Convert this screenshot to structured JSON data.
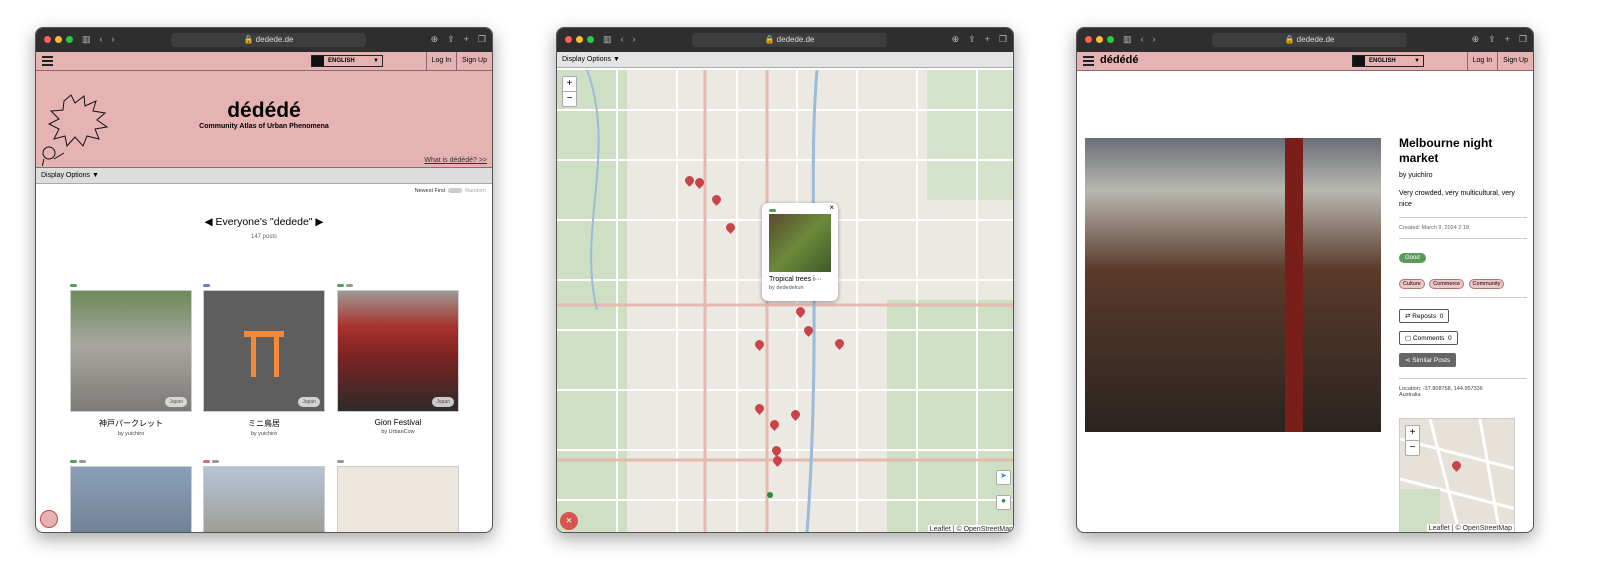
{
  "browser": {
    "url": "dedede.de"
  },
  "home": {
    "language": "ENGLISH",
    "login": "Log In",
    "signup": "Sign Up",
    "site_title": "dédédé",
    "tagline": "Community Atlas of Urban Phenomena",
    "about_link": "What is dédédé? >>",
    "display_options": "Display Options ▼",
    "sort_left": "Newest First",
    "sort_right": "Random",
    "feed_title": "Everyone's \"dedede\"",
    "post_count": "147 posts",
    "posts": [
      {
        "title": "神戸パークレット",
        "author": "by yuichiro",
        "country": "Japan"
      },
      {
        "title": "ミニ鳥居",
        "author": "by yuichiro",
        "country": "Japan"
      },
      {
        "title": "Gion Festival",
        "author": "by UrbanCow",
        "country": "Japan"
      }
    ]
  },
  "map": {
    "display_options": "Display Options ▼",
    "zoom_in": "+",
    "zoom_out": "−",
    "popup": {
      "title": "Tropical trees i···",
      "author": "by dededekun",
      "close": "×"
    },
    "attribution": "Leaflet | © OpenStreetMap"
  },
  "detail": {
    "site_title": "dédédé",
    "language": "ENGLISH",
    "login": "Log In",
    "signup": "Sign Up",
    "title": "Melbourne night market",
    "author": "by yuichiro",
    "description": "Very crowded, very multicultural, very nice",
    "created": "Created: March 9, 2024 2:18",
    "rating": "Good",
    "tags": [
      "Culture",
      "Commerce",
      "Community"
    ],
    "reposts_label": "Reposts",
    "reposts": "0",
    "comments_label": "Comments",
    "comments": "0",
    "similar": "Similar Posts",
    "location": "Location: -37.808758, 144.957336",
    "country": "Australia"
  }
}
